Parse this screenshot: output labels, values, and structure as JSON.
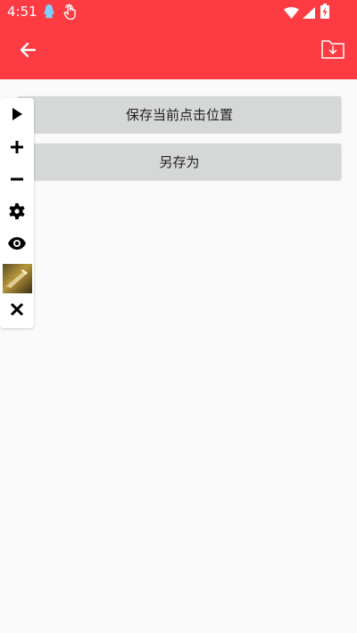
{
  "status_bar": {
    "time": "4:51",
    "icons": [
      "qq-penguin-icon",
      "touch-hand-icon",
      "wifi-icon",
      "signal-icon",
      "battery-charging-icon"
    ]
  },
  "app_bar": {
    "color": "#fd3b43",
    "back_icon": "arrow-left-icon",
    "action_icon": "folder-download-icon"
  },
  "main": {
    "save_position_label": "保存当前点击位置",
    "save_as_label": "另存为"
  },
  "floating_toolbar": {
    "items": [
      "play-icon",
      "plus-icon",
      "minus-icon",
      "gear-icon",
      "eye-icon",
      "game-thumbnail",
      "close-icon"
    ]
  }
}
